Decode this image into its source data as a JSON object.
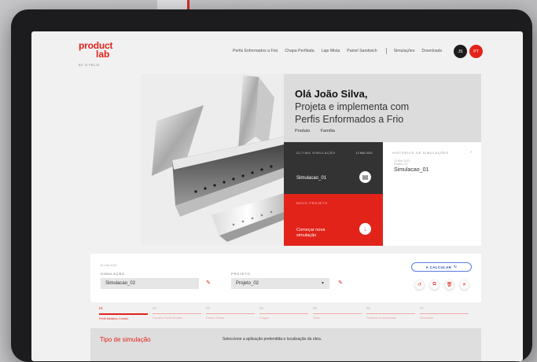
{
  "header": {
    "logo_line1": "product",
    "logo_line2": "lab",
    "logo_sub": "BY O FELIX",
    "nav": [
      "Perfis Enformados a Frio",
      "Chapa Perfilada",
      "Laje Mista",
      "Painel Sandwich",
      "Simulações",
      "Downloads"
    ],
    "avatar_dark": "JS",
    "avatar_red": "PT"
  },
  "greeting": {
    "hello": "Olá João Silva,",
    "line1": "Projeta e implementa com",
    "line2": "Perfis Enformados a Frio",
    "tab1": "Produto",
    "tab2": "Família"
  },
  "card_last": {
    "label": "ÚLTIMA SIMULAÇÃO",
    "date": "12 MAI 2021",
    "name": "Simulacao_01"
  },
  "card_new": {
    "label": "NOVO PROJETO",
    "name": "Começar nova simulação"
  },
  "card_history": {
    "label": "HISTÓRICO DE SIMULAÇÕES",
    "date1": "12 MAI 2021",
    "date2": "Projeto_01",
    "name": "Simulacao_01"
  },
  "form": {
    "date": "12 mai 2021",
    "sim_label": "SIMULAÇÃO",
    "sim_value": "Simulacao_02",
    "proj_label": "PROJETO",
    "proj_value": "Projeto_02",
    "calc_label": "A CALCULAR"
  },
  "steps": [
    {
      "num": "01",
      "label": "Perfil Metálico Corrido"
    },
    {
      "num": "02",
      "label": "Escolha Perfil Metálico"
    },
    {
      "num": "03",
      "label": "Dados Gerais"
    },
    {
      "num": "04",
      "label": "Cargas"
    },
    {
      "num": "05",
      "label": "Vãos"
    },
    {
      "num": "06",
      "label": "Parâmetros Adicionais"
    },
    {
      "num": "07",
      "label": "Resultado"
    }
  ],
  "bottom": {
    "title": "Tipo de simulação",
    "description": "Seleccione a aplicação pretendida e localização da obra."
  },
  "colors": {
    "brand": "#e2231a",
    "dark": "#333333",
    "accent_blue": "#2b4eb5"
  }
}
